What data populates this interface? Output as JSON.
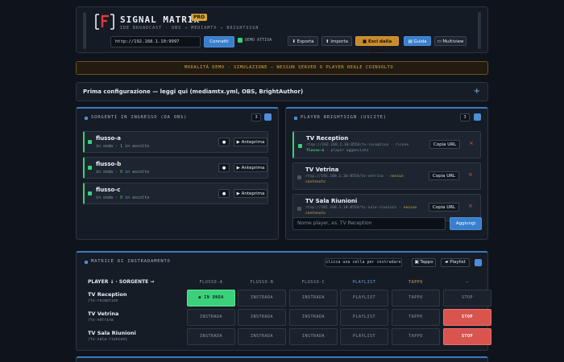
{
  "header": {
    "brand": "SIGNAL MATRIX",
    "logo_glyph": "[F]",
    "pro_badge": "PRO",
    "tagline": "IDE BROADCAST · OBS → MEDIAMTX → BRIGHTSIGN",
    "url_value": "http://192.168.1.10:9997",
    "connect_label": "Connetti",
    "demo_label": "DEMO ATTIVA",
    "buttons": {
      "export": "Esporta",
      "import": "Importa",
      "exit_demo": "Esci dalla demo",
      "guide": "Guida",
      "multiview": "Multiview"
    }
  },
  "banner": {
    "text": "MODALITÀ DEMO · SIMULAZIONE — NESSUN SERVER O PLAYER REALE COINVOLTO"
  },
  "setup": {
    "title": "Prima configurazione — leggi qui (mediamtx.yml, OBS, BrightAuthor)",
    "toggle": "+"
  },
  "sources": {
    "title": "SORGENTI IN INGRESSO (DA OBS)",
    "count": "3",
    "preview_label": "▶ Anteprima",
    "record_glyph": "●",
    "items": [
      {
        "name": "flusso-a",
        "status_prefix": "in onda · ",
        "listeners": "1",
        "status_suffix": " in ascolto"
      },
      {
        "name": "flusso-b",
        "status_prefix": "in onda · ",
        "listeners": "0",
        "status_suffix": " in ascolto"
      },
      {
        "name": "flusso-c",
        "status_prefix": "in onda · ",
        "listeners": "0",
        "status_suffix": " in ascolto"
      }
    ]
  },
  "players": {
    "title": "PLAYER BRIGHTSIGN (USCITE)",
    "count": "3",
    "copy_label": "Copia URL",
    "delete_glyph": "×",
    "items": [
      {
        "name": "TV Reception",
        "url": "rtsp://192.168.1.10:8554/tv-reception · riceve ",
        "state": "flusso-a",
        "suffix": " · player agganciato",
        "active": true
      },
      {
        "name": "TV Vetrina",
        "url": "rtsp://192.168.1.10:8554/tv-vetrina · ",
        "state": "nessun contenuto",
        "suffix": "",
        "active": false
      },
      {
        "name": "TV Sala Riunioni",
        "url": "rtsp://192.168.1.10:8554/tv-sala-riunioni · ",
        "state": "nessun contenuto",
        "suffix": "",
        "active": false
      }
    ],
    "name_placeholder": "Nome player, es. TV Reception",
    "add_label": "Aggiungi"
  },
  "matrix": {
    "title": "MATRICE DI INSTRADAMENTO",
    "hint": "clicca una cella per instradare",
    "tappo_button": "Tappo",
    "playlist_button": "Playlist",
    "corner_label": "PLAYER ↓ · SORGENTE →",
    "columns": [
      "FLUSSO-A",
      "FLUSSO-B",
      "FLUSSO-C",
      "PLAYLIST",
      "TAPPO",
      "—"
    ],
    "rows": [
      {
        "name": "TV Reception",
        "path": "/tv-reception",
        "cells": [
          "● IN ONDA",
          "INSTRADA",
          "INSTRADA",
          "PLAYLIST",
          "TAPPO",
          "STOP"
        ],
        "live_index": 0,
        "stop_active": false
      },
      {
        "name": "TV Vetrina",
        "path": "/tv-vetrina",
        "cells": [
          "INSTRADA",
          "INSTRADA",
          "INSTRADA",
          "PLAYLIST",
          "TAPPO",
          "STOP"
        ],
        "live_index": -1,
        "stop_active": true
      },
      {
        "name": "TV Sala Riunioni",
        "path": "/tv-sala-riunioni",
        "cells": [
          "INSTRADA",
          "INSTRADA",
          "INSTRADA",
          "PLAYLIST",
          "TAPPO",
          "STOP"
        ],
        "live_index": -1,
        "stop_active": true
      }
    ]
  },
  "colors": {
    "accent_blue": "#3c78c4",
    "live_green": "#3bd07a",
    "stop_red": "#d9534f",
    "demo_orange": "#d7a64a"
  }
}
